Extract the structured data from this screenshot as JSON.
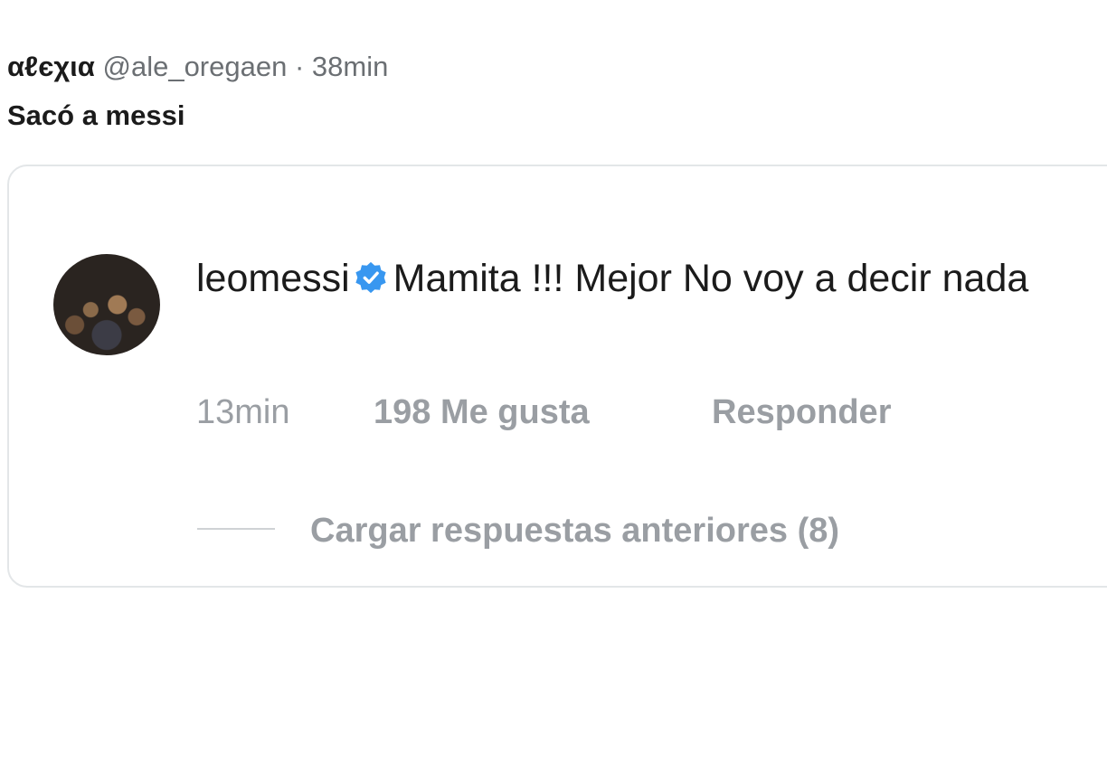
{
  "tweet": {
    "display_name": "αℓєχια",
    "handle": "@ale_oregaen",
    "separator": "·",
    "time": "38min",
    "text": "Sacó a messi"
  },
  "quoted_comment": {
    "username": "leomessi",
    "verified_icon": "verified-badge-icon",
    "text": "Mamita !!! Mejor No voy a decir nada",
    "time": "13min",
    "likes": "198 Me gusta",
    "reply_label": "Responder",
    "load_replies_label": "Cargar respuestas anteriores (8)"
  },
  "colors": {
    "verified": "#3897f0",
    "muted_text": "#9a9ea3",
    "border": "#e3e6e8"
  }
}
